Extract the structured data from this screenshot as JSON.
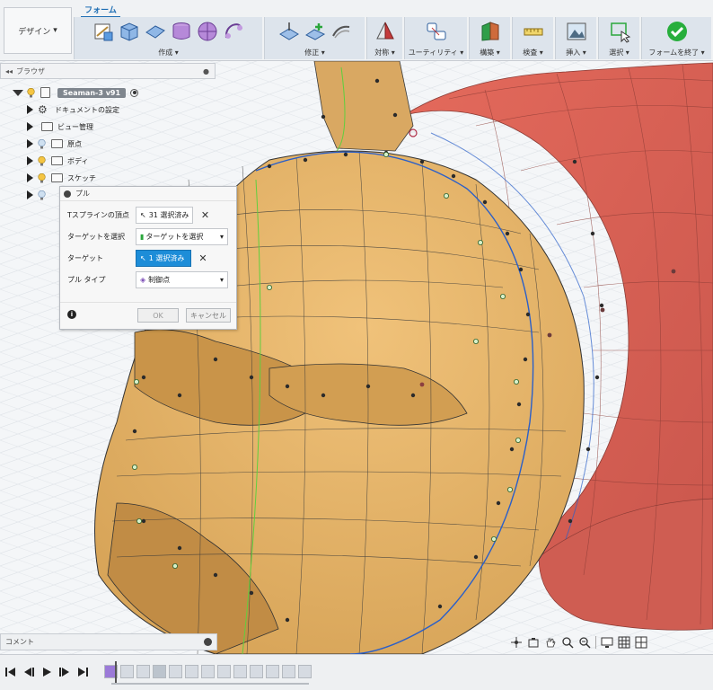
{
  "ribbon": {
    "workspace_button": "デザイン",
    "active_tab": "フォーム",
    "groups": [
      {
        "label": "作成 ▾"
      },
      {
        "label": "修正 ▾"
      },
      {
        "label": "対称 ▾"
      },
      {
        "label": "ユーティリティ ▾"
      },
      {
        "label": "構築 ▾"
      },
      {
        "label": "検査 ▾"
      },
      {
        "label": "挿入 ▾"
      },
      {
        "label": "選択 ▾"
      },
      {
        "label": "フォームを終了 ▾"
      }
    ]
  },
  "browser": {
    "title": "ブラウザ",
    "root": "Seaman-3 v91",
    "items": [
      {
        "label": "ドキュメントの設定"
      },
      {
        "label": "ビュー管理"
      },
      {
        "label": "原点"
      },
      {
        "label": "ボディ"
      },
      {
        "label": "スケッチ"
      }
    ]
  },
  "pull_dialog": {
    "title": "プル",
    "rows": [
      {
        "label": "Tスプラインの頂点",
        "value": "31 選択済み"
      },
      {
        "label": "ターゲットを選択",
        "value": "ターゲットを選択"
      },
      {
        "label": "ターゲット",
        "value": "1 選択済み"
      },
      {
        "label": "プル タイプ",
        "value": "制御点"
      }
    ],
    "ok_label": "OK",
    "cancel_label": "キャンセル"
  },
  "comment_bar": {
    "label": "コメント"
  },
  "colors": {
    "accent": "#1f6fb4",
    "selected_button": "#1d8dd8",
    "face_body": "#e4b46a",
    "back_body": "#d8665b",
    "finish_form": "#27ae3c"
  }
}
